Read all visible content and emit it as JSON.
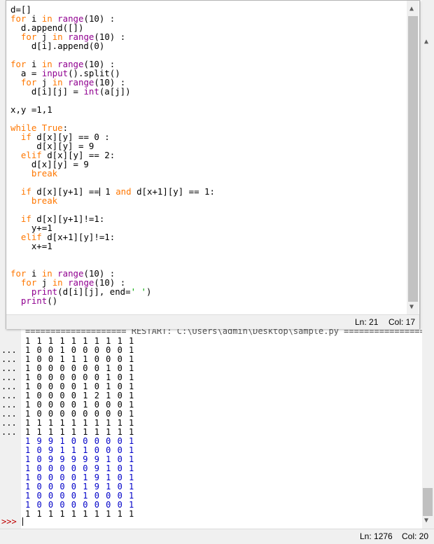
{
  "editor": {
    "lines": [
      [
        {
          "t": "d=[]"
        }
      ],
      [
        {
          "t": "for",
          "c": "kw"
        },
        {
          "t": " i "
        },
        {
          "t": "in",
          "c": "kw"
        },
        {
          "t": " "
        },
        {
          "t": "range",
          "c": "bi"
        },
        {
          "t": "(10) :"
        }
      ],
      [
        {
          "t": "  d.append([])"
        }
      ],
      [
        {
          "t": "  "
        },
        {
          "t": "for",
          "c": "kw"
        },
        {
          "t": " j "
        },
        {
          "t": "in",
          "c": "kw"
        },
        {
          "t": " "
        },
        {
          "t": "range",
          "c": "bi"
        },
        {
          "t": "(10) :"
        }
      ],
      [
        {
          "t": "    d[i].append(0)"
        }
      ],
      [
        {
          "t": ""
        }
      ],
      [
        {
          "t": "for",
          "c": "kw"
        },
        {
          "t": " i "
        },
        {
          "t": "in",
          "c": "kw"
        },
        {
          "t": " "
        },
        {
          "t": "range",
          "c": "bi"
        },
        {
          "t": "(10) :"
        }
      ],
      [
        {
          "t": "  a = "
        },
        {
          "t": "input",
          "c": "bi"
        },
        {
          "t": "().split()"
        }
      ],
      [
        {
          "t": "  "
        },
        {
          "t": "for",
          "c": "kw"
        },
        {
          "t": " j "
        },
        {
          "t": "in",
          "c": "kw"
        },
        {
          "t": " "
        },
        {
          "t": "range",
          "c": "bi"
        },
        {
          "t": "(10) :"
        }
      ],
      [
        {
          "t": "    d[i][j] = "
        },
        {
          "t": "int",
          "c": "bi"
        },
        {
          "t": "(a[j])"
        }
      ],
      [
        {
          "t": ""
        }
      ],
      [
        {
          "t": "x,y =1,1"
        }
      ],
      [
        {
          "t": ""
        }
      ],
      [
        {
          "t": "while",
          "c": "kw"
        },
        {
          "t": " "
        },
        {
          "t": "True",
          "c": "kw"
        },
        {
          "t": ":"
        }
      ],
      [
        {
          "t": "  "
        },
        {
          "t": "if",
          "c": "kw"
        },
        {
          "t": " d[x][y] == 0 :"
        }
      ],
      [
        {
          "t": "     d[x][y] = 9"
        }
      ],
      [
        {
          "t": "  "
        },
        {
          "t": "elif",
          "c": "kw"
        },
        {
          "t": " d[x][y] == 2:"
        }
      ],
      [
        {
          "t": "    d[x][y] = 9"
        }
      ],
      [
        {
          "t": "    "
        },
        {
          "t": "break",
          "c": "kw"
        }
      ],
      [
        {
          "t": ""
        }
      ],
      [
        {
          "t": "  "
        },
        {
          "t": "if",
          "c": "kw"
        },
        {
          "t": " d[x][y+1] =="
        },
        {
          "t": "",
          "caret": true
        },
        {
          "t": " 1 "
        },
        {
          "t": "and",
          "c": "kw"
        },
        {
          "t": " d[x+1][y] == 1:"
        }
      ],
      [
        {
          "t": "    "
        },
        {
          "t": "break",
          "c": "kw"
        }
      ],
      [
        {
          "t": ""
        }
      ],
      [
        {
          "t": "  "
        },
        {
          "t": "if",
          "c": "kw"
        },
        {
          "t": " d[x][y+1]!=1:"
        }
      ],
      [
        {
          "t": "    y+=1"
        }
      ],
      [
        {
          "t": "  "
        },
        {
          "t": "elif",
          "c": "kw"
        },
        {
          "t": " d[x+1][y]!=1:"
        }
      ],
      [
        {
          "t": "    x+=1"
        }
      ],
      [
        {
          "t": ""
        }
      ],
      [
        {
          "t": ""
        }
      ],
      [
        {
          "t": "for",
          "c": "kw"
        },
        {
          "t": " i "
        },
        {
          "t": "in",
          "c": "kw"
        },
        {
          "t": " "
        },
        {
          "t": "range",
          "c": "bi"
        },
        {
          "t": "(10) :"
        }
      ],
      [
        {
          "t": "  "
        },
        {
          "t": "for",
          "c": "kw"
        },
        {
          "t": " j "
        },
        {
          "t": "in",
          "c": "kw"
        },
        {
          "t": " "
        },
        {
          "t": "range",
          "c": "bi"
        },
        {
          "t": "(10) :"
        }
      ],
      [
        {
          "t": "    "
        },
        {
          "t": "print",
          "c": "bi"
        },
        {
          "t": "(d[i][j], end="
        },
        {
          "t": "' '",
          "c": "str"
        },
        {
          "t": ")"
        }
      ],
      [
        {
          "t": "  "
        },
        {
          "t": "print",
          "c": "bi"
        },
        {
          "t": "()"
        }
      ]
    ],
    "status": {
      "ln": "Ln: 21",
      "col": "Col: 17"
    }
  },
  "shell": {
    "restart": "==================== RESTART: C:\\Users\\admin\\Desktop\\sample.py ===================",
    "gutter": [
      "...",
      "...",
      "...",
      "...",
      "...",
      "...",
      "...",
      "...",
      "...",
      "..."
    ],
    "prompt": ">>>",
    "input_lines": [
      "1 1 1 1 1 1 1 1 1 1",
      "1 0 0 1 0 0 0 0 0 1",
      "1 0 0 1 1 1 0 0 0 1",
      "1 0 0 0 0 0 0 1 0 1",
      "1 0 0 0 0 0 0 1 0 1",
      "1 0 0 0 0 1 0 1 0 1",
      "1 0 0 0 0 1 2 1 0 1",
      "1 0 0 0 0 1 0 0 0 1",
      "1 0 0 0 0 0 0 0 0 1",
      "1 1 1 1 1 1 1 1 1 1"
    ],
    "output_lines": [
      "1 1 1 1 1 1 1 1 1 1",
      "1 9 9 1 0 0 0 0 0 1",
      "1 0 9 1 1 1 0 0 0 1",
      "1 0 9 9 9 9 9 1 0 1",
      "1 0 0 0 0 0 9 1 0 1",
      "1 0 0 0 0 1 9 1 0 1",
      "1 0 0 0 0 1 9 1 0 1",
      "1 0 0 0 0 1 0 0 0 1",
      "1 0 0 0 0 0 0 0 0 1",
      "1 1 1 1 1 1 1 1 1 1"
    ],
    "status": {
      "ln": "Ln: 1276",
      "col": "Col: 20"
    }
  },
  "icons": {
    "scroll_up": "up-arrow-icon",
    "scroll_down": "down-arrow-icon"
  }
}
